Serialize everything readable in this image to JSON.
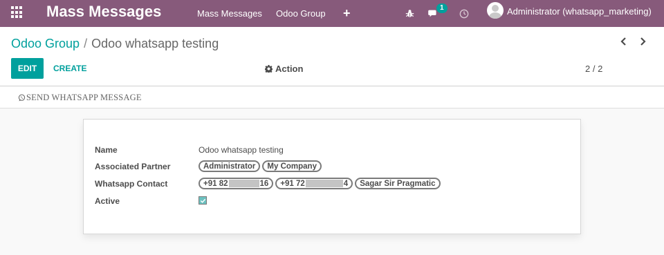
{
  "navbar": {
    "brand": "Mass Messages",
    "menu": [
      "Mass Messages",
      "Odoo Group"
    ],
    "plus": "+",
    "chat_badge": "1",
    "user": "Administrator (whatsapp_marketing)"
  },
  "breadcrumb": {
    "parent": "Odoo Group",
    "separator": "/",
    "current": "Odoo whatsapp testing"
  },
  "buttons": {
    "edit": "EDIT",
    "create": "CREATE",
    "action": "Action"
  },
  "pager": {
    "value": "2 / 2"
  },
  "statusbar": {
    "send_label": "SEND WHATSAPP MESSAGE"
  },
  "form": {
    "name_label": "Name",
    "name_value": "Odoo whatsapp testing",
    "partner_label": "Associated Partner",
    "partners": [
      "Administrator",
      "My Company"
    ],
    "contact_label": "Whatsapp Contact",
    "contact_1_prefix": "+91 82",
    "contact_1_suffix": "16",
    "contact_2_prefix": "+91 72",
    "contact_2_suffix": "4",
    "contact_3": "Sagar Sir Pragmatic",
    "active_label": "Active",
    "active": true
  },
  "colors": {
    "navbar": "#875a7b",
    "primary": "#00a09d",
    "text": "#4c4c4c"
  }
}
